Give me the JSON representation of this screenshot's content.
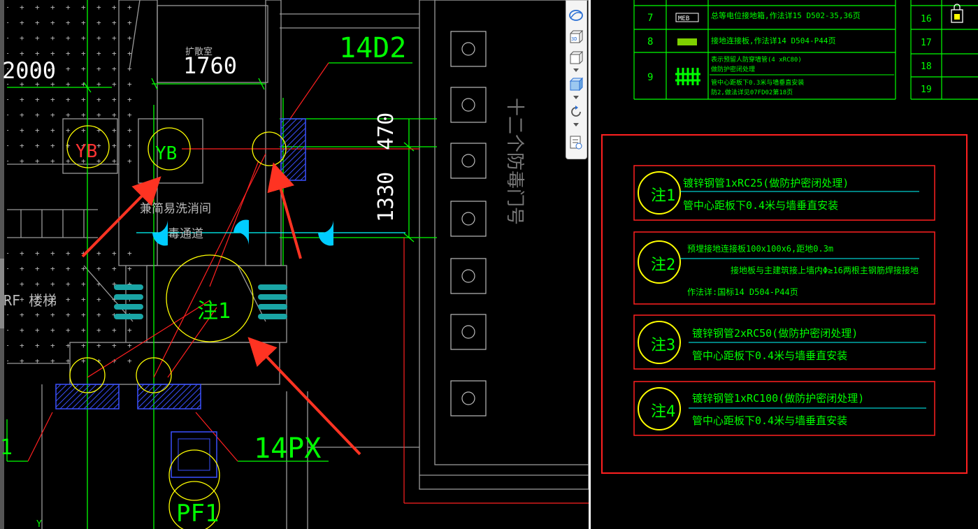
{
  "drawing": {
    "dim_top": "2000",
    "dim_1760": "1760",
    "dim_470": "470",
    "dim_1330": "1330",
    "label_14d2": "14D2",
    "label_14px": "14PX",
    "label_pf1": "PF1",
    "label_yb_a": "YB",
    "label_yb_b": "YB",
    "label_note1": "注1",
    "room_small": "扩散室",
    "room_wash": "兼简易洗消间",
    "room_decon": "毒通道",
    "label_stairs": "RF 楼梯",
    "label_vertical": "十二个防毒门号",
    "label_left_edge": "1",
    "axis_y": "Y"
  },
  "legend": {
    "rows": [
      {
        "num": "7",
        "symbol": "MEB",
        "desc": "总等电位接地箱,作法详15 D502-35,36页"
      },
      {
        "num": "8",
        "symbol": "",
        "desc": "接地连接板,作法详14 D504-P44页"
      },
      {
        "num": "9",
        "symbol": "",
        "desc_lines": [
          "表示预留人防穿墙管(4 xRC80)",
          "做防护密闭处理",
          "管中心距板下0.3米与墙垂直安装",
          "防2,做法详见07FD02第18页"
        ]
      }
    ],
    "right_rows": [
      "16",
      "17",
      "18",
      "19"
    ]
  },
  "notes": [
    {
      "tag": "注1",
      "line1": "镀锌钢管1xRC25(做防护密闭处理)",
      "line2": "管中心距板下0.4米与墙垂直安装"
    },
    {
      "tag": "注2",
      "line1": "预埋接地连接板100x100x6,距地0.3m",
      "line2": "接地板与主建筑接上墙内Φ≥16两根主钢筋焊接接地",
      "line3": "作法详:国标14 D504-P44页"
    },
    {
      "tag": "注3",
      "line1": "镀锌钢管2xRC50(做防护密闭处理)",
      "line2": "管中心距板下0.4米与墙垂直安装"
    },
    {
      "tag": "注4",
      "line1": "镀锌钢管1xRC100(做防护密闭处理)",
      "line2": "管中心距板下0.4米与墙垂直安装"
    }
  ],
  "toolbar": {
    "tools": [
      "orbit-icon",
      "3d-view-icon",
      "cube-view-icon",
      "shaded-cube-icon",
      "rotate-icon",
      "properties-icon"
    ]
  },
  "colors": {
    "green": "#00ff00",
    "red": "#ff2020",
    "yellow": "#ffff00",
    "cyan": "#00ffff",
    "blue": "#3a50ff",
    "gray": "#9a9a9a",
    "white": "#ffffff",
    "arrow": "#ff3322"
  }
}
